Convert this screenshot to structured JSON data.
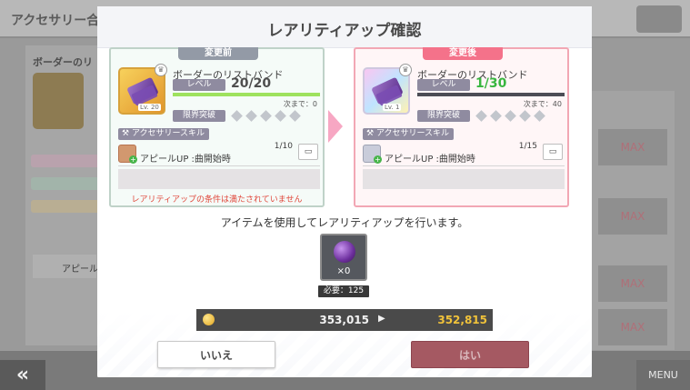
{
  "background": {
    "screen_title": "アクセサリー合",
    "left_sub": "ボーダーのリ",
    "left_skill": "アピール",
    "max_labels": [
      "MAX",
      "MAX",
      "MAX",
      "MAX"
    ],
    "back_label": "«",
    "menu_label": "MENU"
  },
  "dialog": {
    "title": "レアリティアップ確認",
    "before": {
      "tag": "変更前",
      "item_name": "ボーダーのリストバンド",
      "level_label": "レベル",
      "level": "20/20",
      "icon_level": "Lv. 20",
      "next_exp": "次まで：0",
      "limit_break_label": "限界突破",
      "skill_label": "アクセサリースキル",
      "skill_name": "アピールUP :曲開始時",
      "skill_count": "1/10",
      "warning": "レアリティアップの条件は満たされていません"
    },
    "after": {
      "tag": "変更後",
      "item_name": "ボーダーのリストバンド",
      "level_label": "レベル",
      "level": "1/30",
      "icon_level": "Lv. 1",
      "next_exp": "次まで：40",
      "limit_break_label": "限界突破",
      "skill_label": "アクセサリースキル",
      "skill_name": "アピールUP :曲開始時",
      "skill_count": "1/15"
    },
    "confirm_text": "アイテムを使用してレアリティアップを行います。",
    "cost_item": {
      "count": "×0",
      "required": "必要：125"
    },
    "money": {
      "current": "353,015",
      "after": "352,815",
      "arrow": "▶"
    },
    "buttons": {
      "no": "いいえ",
      "yes": "はい"
    }
  },
  "colors": {
    "before_border": "#bfd2c8",
    "after_border": "#f2a7b4",
    "after_level": "#38b63f",
    "warning": "#e0483c",
    "money_after": "#f0c23a",
    "yes_button": "#a55962"
  }
}
